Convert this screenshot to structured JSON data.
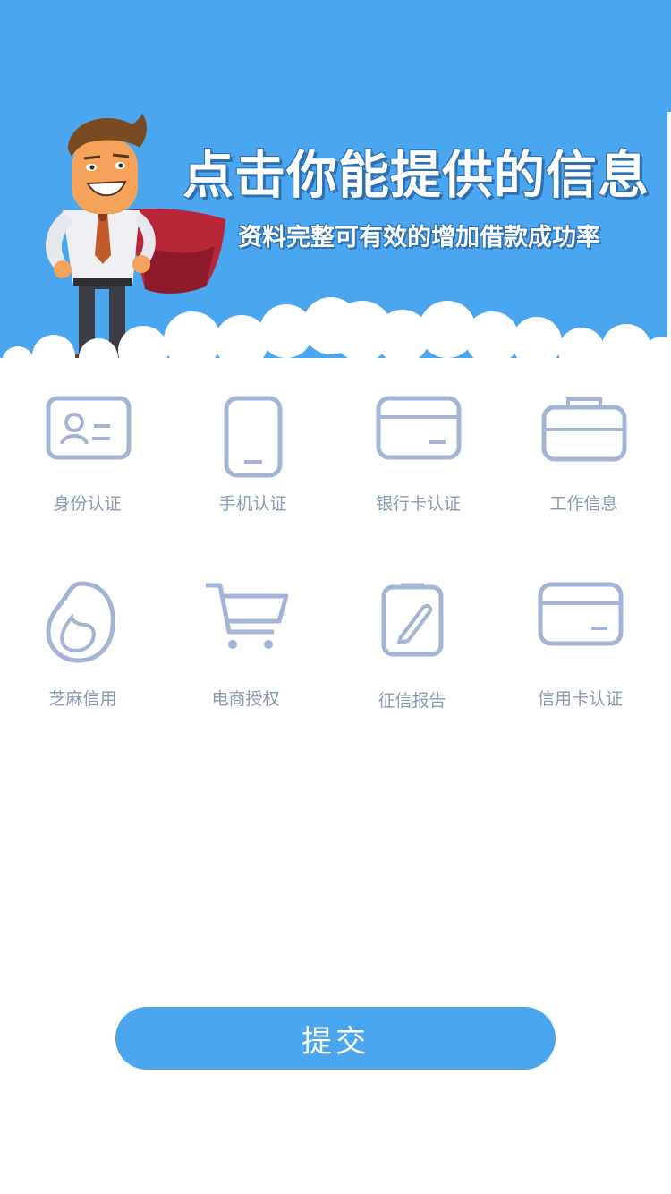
{
  "hero": {
    "title": "点击你能提供的信息",
    "subtitle": "资料完整可有效的增加借款成功率"
  },
  "items": [
    {
      "label": "身份认证",
      "icon": "id-card-icon"
    },
    {
      "label": "手机认证",
      "icon": "phone-icon"
    },
    {
      "label": "银行卡认证",
      "icon": "bank-card-icon"
    },
    {
      "label": "工作信息",
      "icon": "briefcase-icon"
    },
    {
      "label": "芝麻信用",
      "icon": "sesame-credit-icon"
    },
    {
      "label": "电商授权",
      "icon": "shopping-cart-icon"
    },
    {
      "label": "征信报告",
      "icon": "credit-report-icon"
    },
    {
      "label": "信用卡认证",
      "icon": "credit-card-icon"
    }
  ],
  "submit": {
    "label": "提交"
  },
  "colors": {
    "primary": "#4aa6ee",
    "icon": "#a3b4d4",
    "label": "#8a9ab5"
  }
}
